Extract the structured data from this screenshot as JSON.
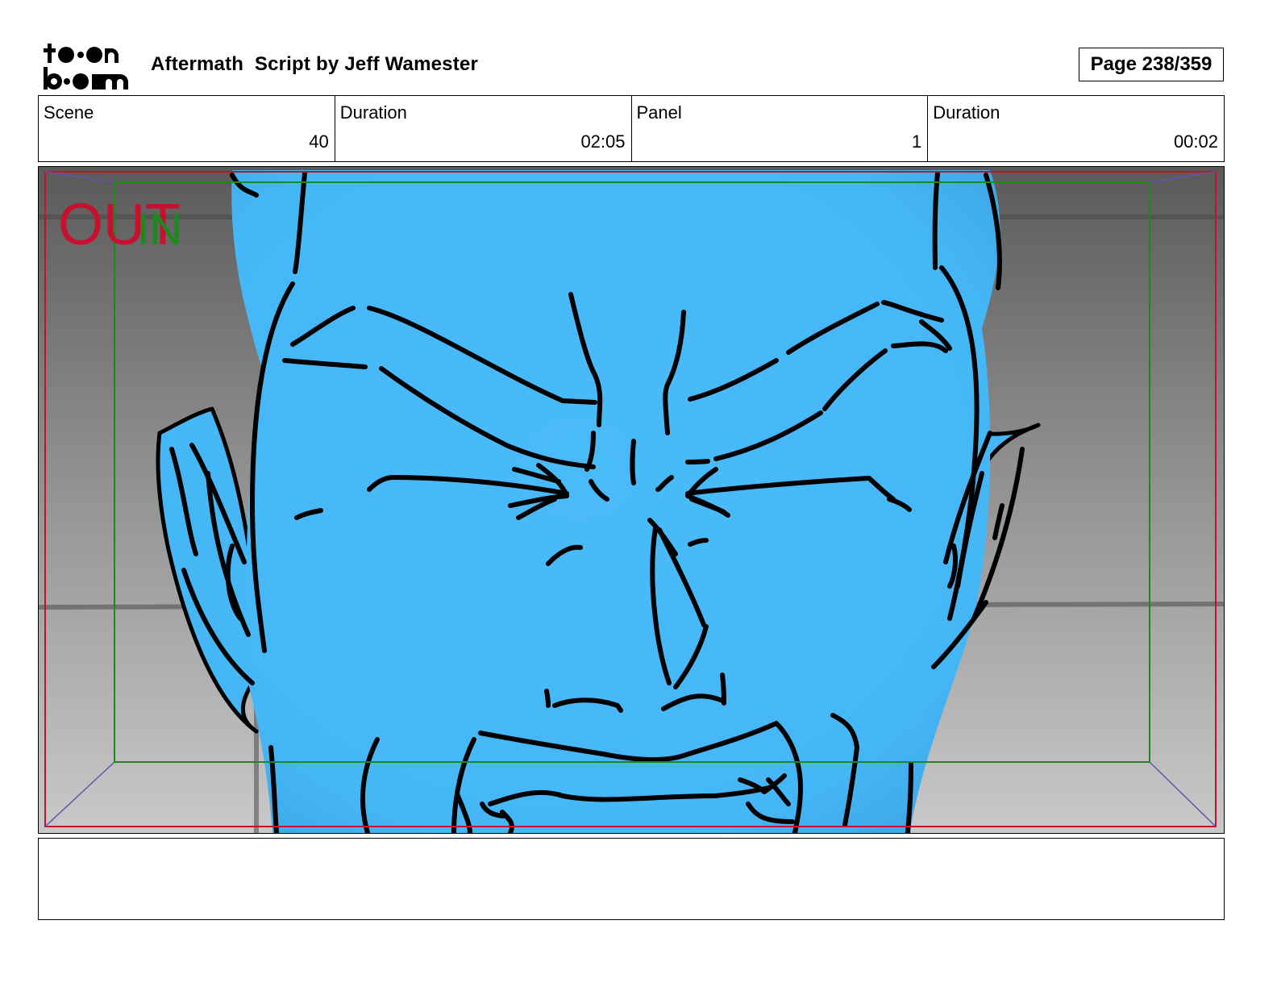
{
  "header": {
    "title": "Aftermath  Script by Jeff Wamester",
    "page": "Page 238/359"
  },
  "info": [
    {
      "label": "Scene",
      "value": "40"
    },
    {
      "label": "Duration",
      "value": "02:05"
    },
    {
      "label": "Panel",
      "value": "1"
    },
    {
      "label": "Duration",
      "value": "00:02"
    }
  ],
  "panel": {
    "frame_labels": {
      "out": "OUT",
      "in": "IN"
    },
    "colors": {
      "skin": "#45b7f7",
      "background_light": "#c9c9c9",
      "background_dark": "#5a5a5a",
      "out_frame": "#c8102e",
      "in_frame": "#1a8a1a",
      "ink": "#000000"
    }
  },
  "notes": ""
}
